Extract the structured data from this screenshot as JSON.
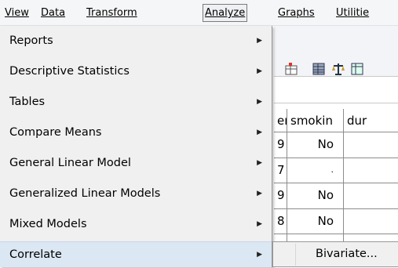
{
  "menubar": {
    "items": [
      {
        "label": "View"
      },
      {
        "label": "Data"
      },
      {
        "label": "Transform"
      },
      {
        "label": "Analyze"
      },
      {
        "label": "Graphs"
      },
      {
        "label": "Utilitie"
      }
    ],
    "active": "Analyze"
  },
  "toolbar": {
    "icons": [
      "chart-icon",
      "table-icon",
      "scale-icon",
      "grid-icon"
    ]
  },
  "grid": {
    "headers": [
      "en",
      "smokin",
      "dur"
    ],
    "rows": [
      {
        "id": "9",
        "smokin": "No"
      },
      {
        "id": "7",
        "smokin": "."
      },
      {
        "id": "9",
        "smokin": "No"
      },
      {
        "id": "8",
        "smokin": "No"
      },
      {
        "id": "",
        "smokin": ""
      }
    ]
  },
  "analyze_menu": {
    "items": [
      {
        "label": "Reports",
        "has_submenu": true
      },
      {
        "label": "Descriptive Statistics",
        "has_submenu": true
      },
      {
        "label": "Tables",
        "has_submenu": true
      },
      {
        "label": "Compare Means",
        "has_submenu": true
      },
      {
        "label": "General Linear Model",
        "has_submenu": true
      },
      {
        "label": "Generalized Linear Models",
        "has_submenu": true
      },
      {
        "label": "Mixed Models",
        "has_submenu": true
      },
      {
        "label": "Correlate",
        "has_submenu": true
      }
    ],
    "highlighted": "Correlate"
  },
  "correlate_submenu": {
    "items": [
      {
        "label": "Bivariate..."
      }
    ]
  },
  "colors": {
    "menu_bg": "#f0f0f0",
    "highlight": "#dbe7f3",
    "menubar_bg": "#f5f6f7"
  }
}
